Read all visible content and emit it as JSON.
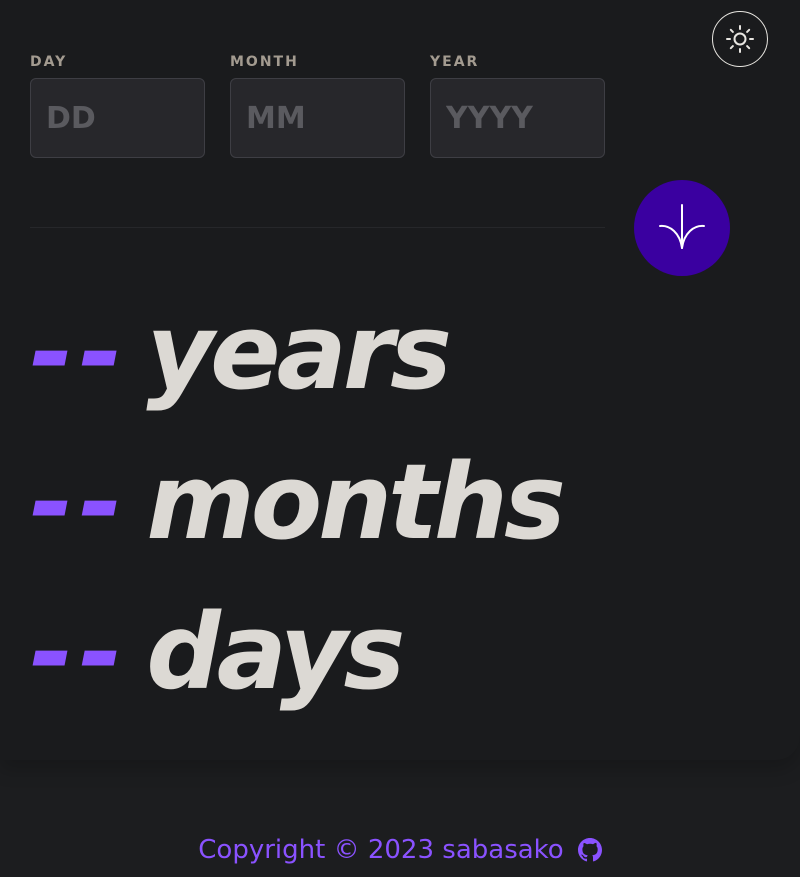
{
  "form": {
    "day": {
      "label": "DAY",
      "value": "",
      "placeholder": "DD"
    },
    "month": {
      "label": "MONTH",
      "value": "",
      "placeholder": "MM"
    },
    "year": {
      "label": "YEAR",
      "value": "",
      "placeholder": "YYYY"
    }
  },
  "results": {
    "years": {
      "value": "--",
      "unit": "years"
    },
    "months": {
      "value": "--",
      "unit": "months"
    },
    "days": {
      "value": "--",
      "unit": "days"
    }
  },
  "footer": {
    "copyright": "Copyright © 2023 sabasako"
  },
  "icons": {
    "theme_toggle": "sun-icon",
    "submit": "arrow-down-icon",
    "github": "github-icon"
  },
  "colors": {
    "accent": "#8a52ff",
    "submit_button": "#3a00a0",
    "background": "#1a1b1d",
    "result_text": "#dcd9d4",
    "label": "#a39b90"
  }
}
